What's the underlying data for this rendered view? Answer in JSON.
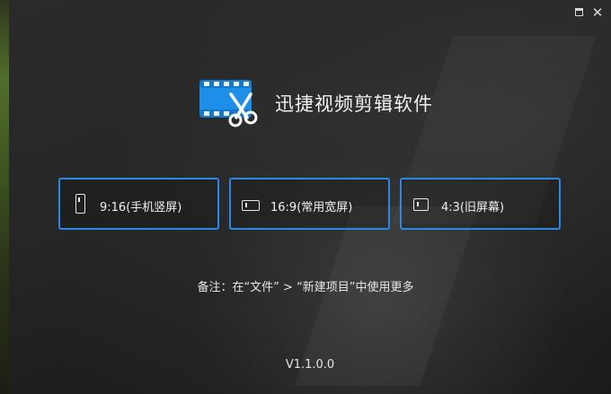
{
  "app": {
    "title": "迅捷视频剪辑软件",
    "version": "V1.1.0.0"
  },
  "titlebar": {
    "restore_icon": "restore-window-icon",
    "close_icon": "close-icon",
    "close_glyph": "✕"
  },
  "ratio_options": [
    {
      "label": "9:16(手机竖屏)",
      "icon": "portrait-screen-icon"
    },
    {
      "label": "16:9(常用宽屏)",
      "icon": "widescreen-icon"
    },
    {
      "label": "4:3(旧屏幕)",
      "icon": "classic-screen-icon"
    }
  ],
  "note": "备注：在“文件” > “新建项目”中使用更多",
  "colors": {
    "accent": "#2b88e6",
    "logo_blue": "#1e8fe8",
    "text": "#f2f2f2"
  }
}
